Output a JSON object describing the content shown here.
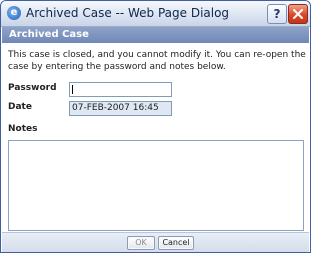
{
  "window": {
    "title": "Archived Case -- Web Page Dialog",
    "help_glyph": "?",
    "app_icon_glyph": "e"
  },
  "header": {
    "title": "Archived Case"
  },
  "message": "This case is closed, and you cannot modify it. You can re-open the case by entering the password and notes below.",
  "form": {
    "password_label": "Password",
    "password_value": "",
    "date_label": "Date",
    "date_value": "07-FEB-2007 16:45",
    "notes_label": "Notes",
    "notes_value": ""
  },
  "buttons": {
    "ok_label": "OK",
    "cancel_label": "Cancel"
  },
  "colors": {
    "header_bar": "#7f95c0",
    "close_button": "#d9472a",
    "title_bar": "#dde5f2"
  }
}
